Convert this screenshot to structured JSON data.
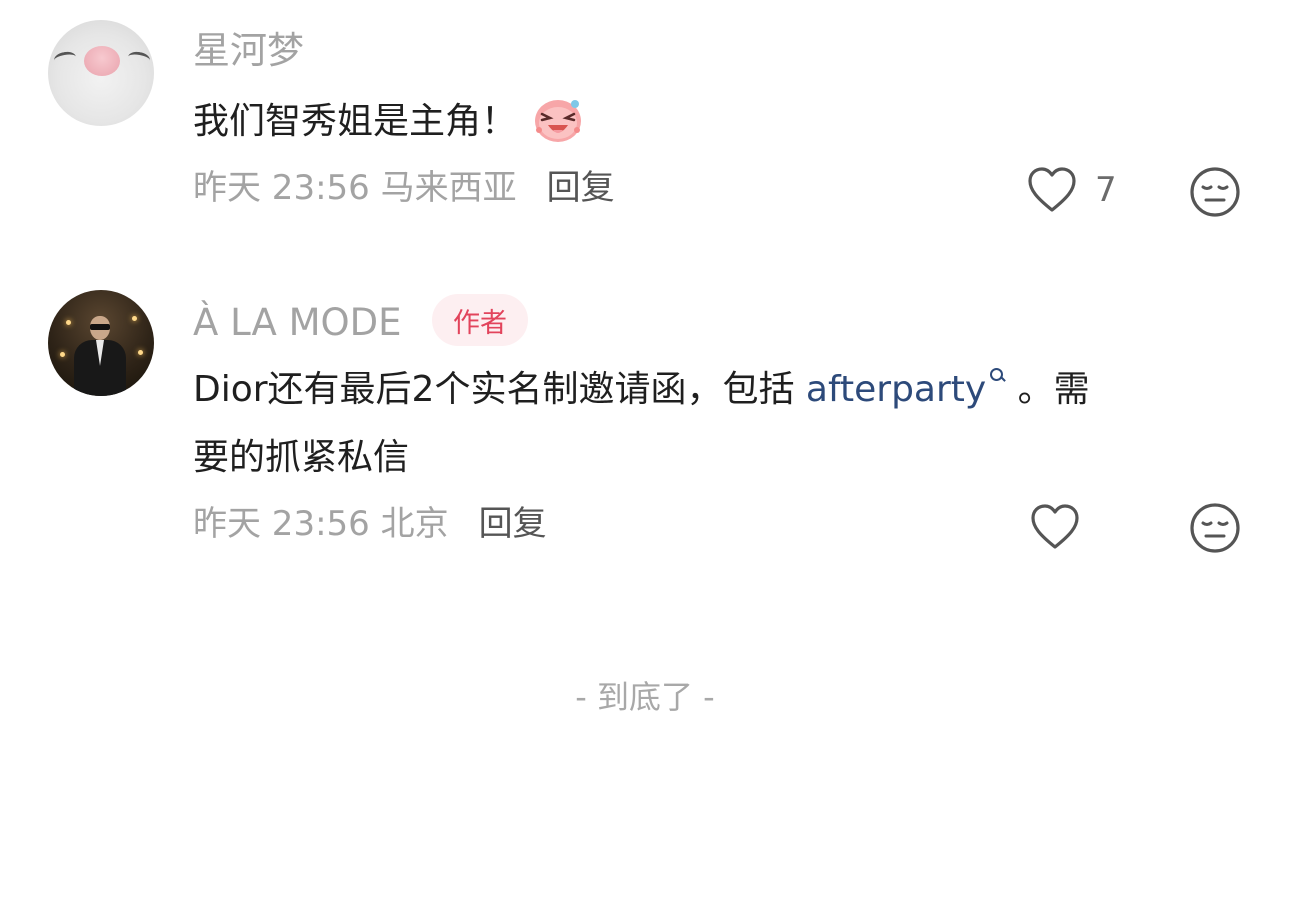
{
  "comments": [
    {
      "username": "星河梦",
      "text": "我们智秀姐是主角！",
      "emoji": "laughing-pink-face-emoji",
      "meta": "昨天 23:56 马来西亚",
      "reply_label": "回复",
      "like_count": "7"
    },
    {
      "username": "À LA MODE",
      "badge": "作者",
      "text_line1_before_link": "Dior还有最后2个实名制邀请函，包括 ",
      "link_text": "afterparty",
      "text_line1_after_link": " 。需",
      "text_line2": "要的抓紧私信",
      "meta": "昨天 23:56 北京",
      "reply_label": "回复",
      "like_count": ""
    }
  ],
  "footer": {
    "end_label": "- 到底了 -"
  },
  "colors": {
    "author_badge_bg": "#fdeff1",
    "author_badge_text": "#e2445c",
    "link": "#2d4a7a",
    "muted": "#a3a3a3"
  }
}
